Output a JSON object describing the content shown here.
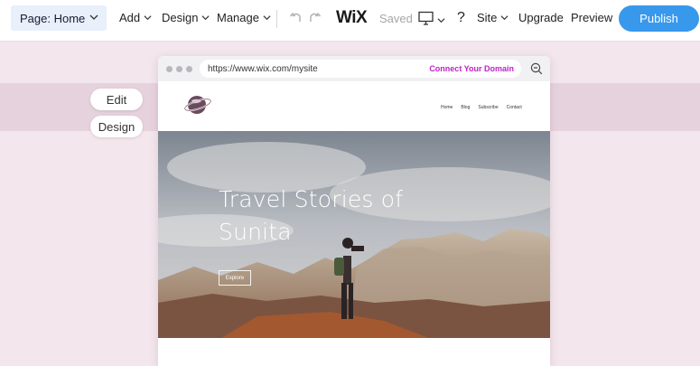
{
  "toolbar": {
    "page_select_label": "Page: Home",
    "add_label": "Add",
    "design_label": "Design",
    "manage_label": "Manage",
    "logo_text": "WiX",
    "saved_label": "Saved",
    "site_label": "Site",
    "upgrade_label": "Upgrade",
    "preview_label": "Preview",
    "publish_label": "Publish",
    "help_label": "?"
  },
  "side_panel": {
    "edit_label": "Edit",
    "design_label": "Design"
  },
  "browser": {
    "url": "https://www.wix.com/mysite",
    "connect_domain_label": "Connect Your Domain"
  },
  "site": {
    "nav": [
      "Home",
      "Blog",
      "Subscribe",
      "Contact"
    ],
    "hero_title": "Travel Stories of Sunita",
    "explore_label": "Explore"
  },
  "colors": {
    "accent": "#3899ec",
    "connect_domain": "#c020c8",
    "canvas_background": "#f3e6ec"
  }
}
